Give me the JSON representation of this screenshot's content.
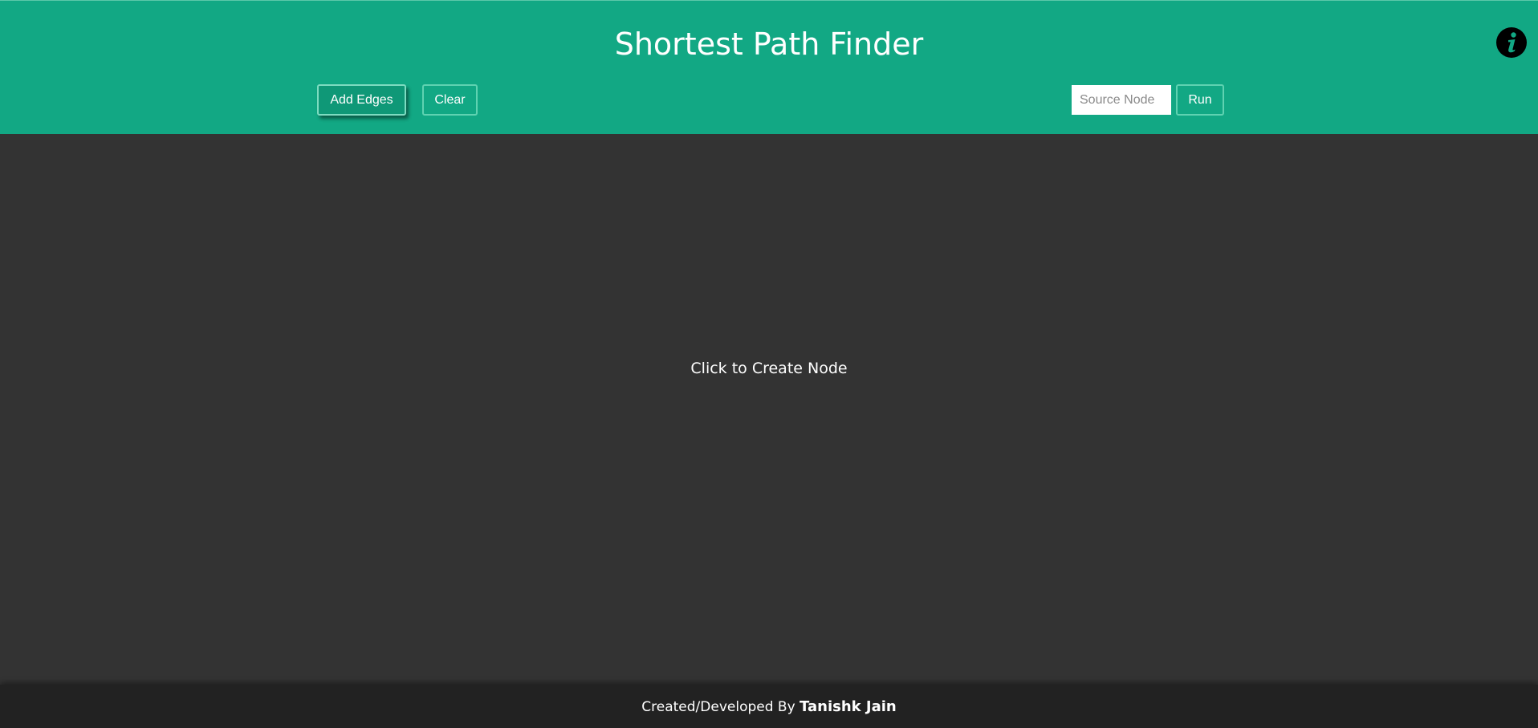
{
  "header": {
    "title": "Shortest Path Finder",
    "add_edges_label": "Add Edges",
    "clear_label": "Clear",
    "source_placeholder": "Source Node",
    "source_value": "",
    "run_label": "Run",
    "info_icon": "info-icon"
  },
  "canvas": {
    "hint": "Click to Create Node"
  },
  "footer": {
    "prefix": "Created/Developed By ",
    "author": "Tanishk Jain"
  },
  "colors": {
    "header_bg": "#12a884",
    "canvas_bg": "#333333",
    "footer_bg": "#222222",
    "button_border": "#5fd2b1",
    "text": "#ffffff"
  }
}
